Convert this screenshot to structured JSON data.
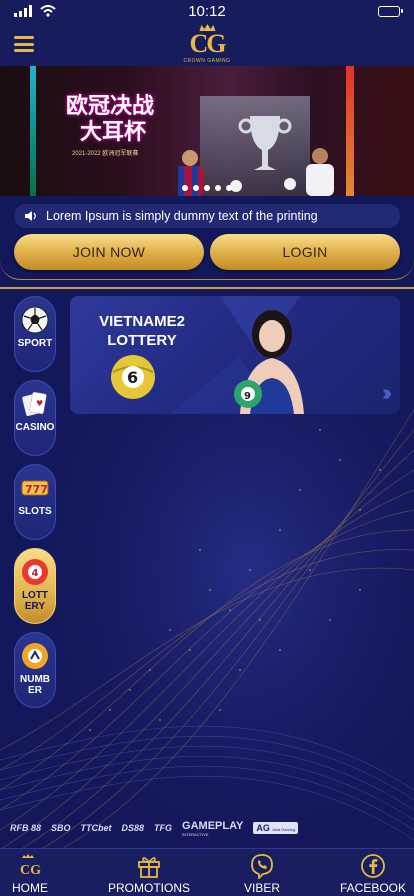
{
  "status_bar": {
    "time": "10:12"
  },
  "header": {
    "logo_mark": "CG",
    "logo_sub": "CROWN GAMING"
  },
  "banner": {
    "title_line1": "欧冠决战",
    "title_line2": "大耳杯",
    "caption": "2021-2022 欧洲冠军联赛",
    "slide_count": 5
  },
  "notice": {
    "text": "Lorem Ipsum is simply dummy text of the printing"
  },
  "cta": {
    "join_label": "JOIN NOW",
    "login_label": "LOGIN"
  },
  "side_nav": [
    {
      "label": "SPORT",
      "icon": "soccer-ball-icon"
    },
    {
      "label": "CASINO",
      "icon": "playing-cards-icon"
    },
    {
      "label": "SLOTS",
      "icon": "slot-777-icon"
    },
    {
      "label": "LOTT ERY",
      "icon": "lottery-ball-icon",
      "active": true
    },
    {
      "label": "NUMB ER",
      "icon": "number-ball-icon"
    }
  ],
  "lottery_card": {
    "title_line1": "VIETNAME2",
    "title_line2": "LOTTERY",
    "ball_number": "6",
    "hostess_ball_number": "9"
  },
  "partners": [
    "RFB 88",
    "SBO",
    "TTCbet",
    "DS88",
    "TFG",
    "GAMEPLAY",
    "AG"
  ],
  "partner_sub": {
    "gameplay": "INTERACTIVE",
    "ag": "Asia Gaming"
  },
  "bottom_nav": [
    {
      "label": "HOME",
      "icon": "home-cg-icon"
    },
    {
      "label": "PROMOTIONS",
      "icon": "gift-icon"
    },
    {
      "label": "VIBER",
      "icon": "viber-icon"
    },
    {
      "label": "FACEBOOK",
      "icon": "facebook-icon"
    }
  ],
  "colors": {
    "background": "#13185a",
    "gold": "#e3b44c",
    "nav_item": "#222b82"
  }
}
